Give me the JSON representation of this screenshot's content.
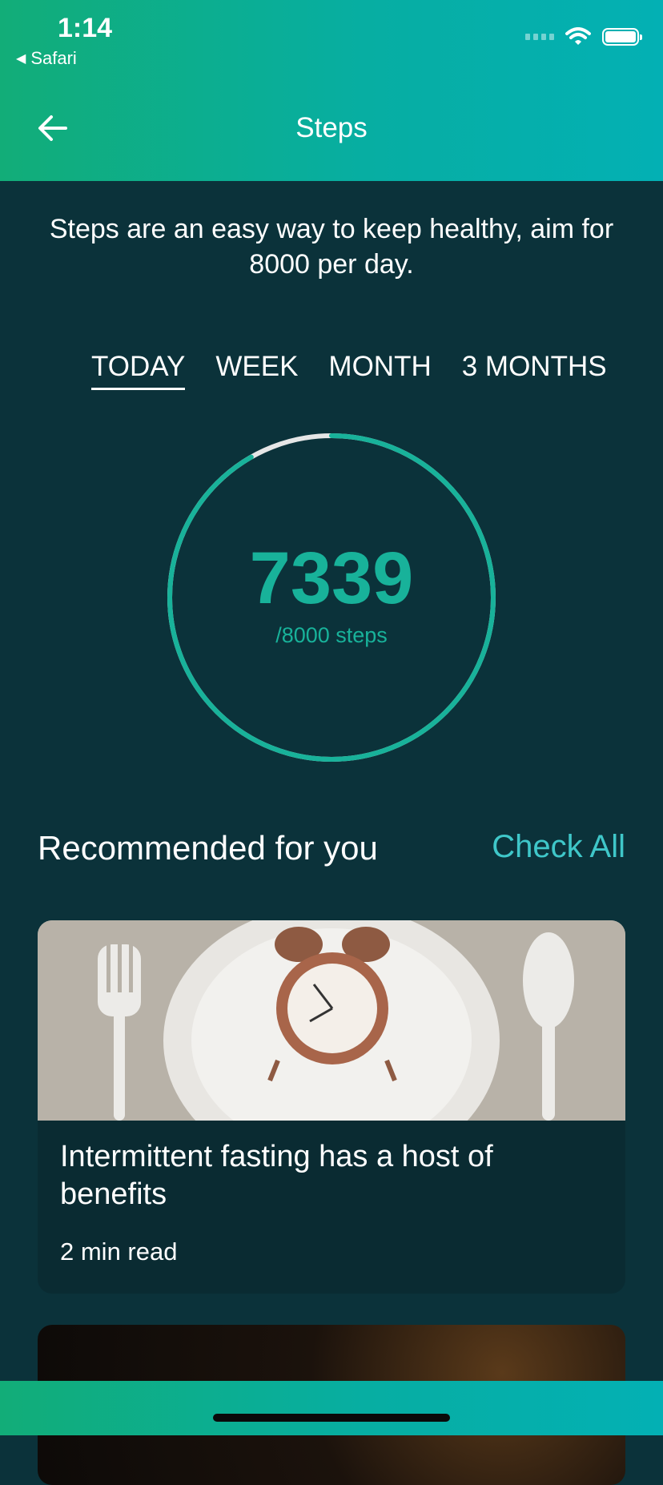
{
  "status_bar": {
    "time": "1:14",
    "back_app": "Safari"
  },
  "header": {
    "title": "Steps"
  },
  "intro": {
    "text": "Steps are an easy way to keep healthy, aim for 8000 per day."
  },
  "tabs": [
    {
      "label": "TODAY",
      "active": true
    },
    {
      "label": "WEEK",
      "active": false
    },
    {
      "label": "MONTH",
      "active": false
    },
    {
      "label": "3 MONTHS",
      "active": false
    }
  ],
  "progress": {
    "steps": "7339",
    "goal_text": "/8000 steps",
    "fraction": 0.917
  },
  "recommended": {
    "heading": "Recommended for you",
    "check_all": "Check All",
    "cards": [
      {
        "title": "Intermittent fasting has a host of benefits",
        "read_time": "2 min read",
        "image": "plate-with-alarm-clock-and-cutlery"
      },
      {
        "image": "dark-food-photo"
      }
    ]
  },
  "colors": {
    "accent": "#18b29a",
    "link": "#3fc7c9",
    "background": "#0b323a",
    "header_start": "#12ad78",
    "header_end": "#03b0b4"
  }
}
